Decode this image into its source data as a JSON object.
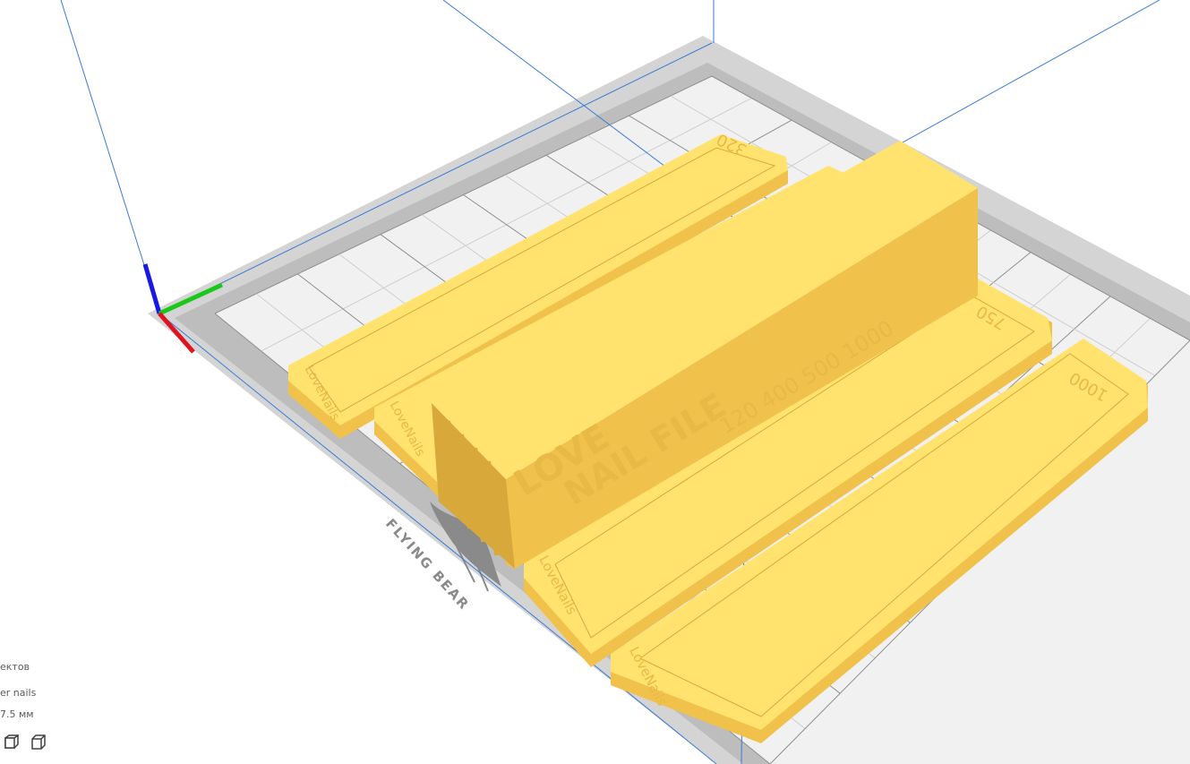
{
  "viewport": {
    "colors": {
      "background": "#ffffff",
      "bed_frame": "#d4d4d4",
      "bed_frame_dark": "#bdbdbd",
      "bed_surface": "#f1f1f1",
      "grid_major": "#8f8f8f",
      "grid_minor": "#cfcfcf",
      "build_volume_line": "#3a7bd5",
      "model_top": "#ffe36e",
      "model_side": "#f0c24c",
      "model_dark": "#d9a83a",
      "model_text": "#e8b944",
      "axis_x": "#e0141e",
      "axis_y": "#19c819",
      "axis_z": "#1919e6",
      "bed_logo": "#8a8a8a"
    },
    "bed_logo_text": "FLYING BEAR",
    "model_labels": {
      "box_title_1": "LOVE",
      "box_title_2": "NAIL FILE",
      "box_grits": "120 400 500 1000",
      "plate_top_grit": "320",
      "plate_right_upper_grit": "750",
      "plate_right_lower_grit": "1000",
      "brand": "LoveNails"
    }
  },
  "info_panel": {
    "line1": "ектов",
    "line2": "er nails",
    "line3": "7.5 мм"
  },
  "view_buttons": [
    {
      "icon": "front-view-cube-icon"
    },
    {
      "icon": "perspective-view-cube-icon"
    }
  ]
}
